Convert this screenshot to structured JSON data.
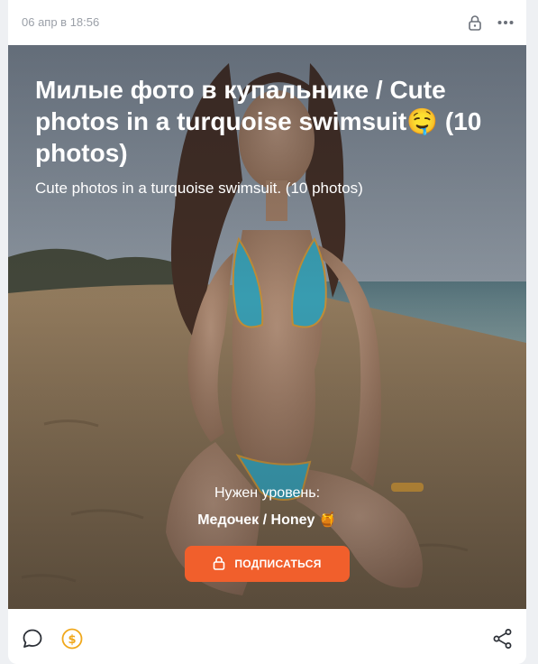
{
  "post": {
    "date": "06 апр в 18:56",
    "title": "Милые фото в купальнике / Cute photos in a turquoise swimsuit🤤 (10 photos)",
    "subtitle": "Cute photos in a turquoise swimsuit. (10 photos)"
  },
  "paywall": {
    "need_level": "Нужен уровень:",
    "level_name": "Медочек / Honey 🍯",
    "subscribe_label": "ПОДПИСАТЬСЯ"
  },
  "icons": {
    "header": [
      "lock-icon",
      "more-icon"
    ],
    "footer": [
      "comment-icon",
      "donate-icon",
      "share-icon"
    ]
  },
  "colors": {
    "accent": "#f15f2c",
    "donate": "#f0a81c",
    "muted_text": "#9ba0a8",
    "swimsuit": "#3fb3c9"
  }
}
